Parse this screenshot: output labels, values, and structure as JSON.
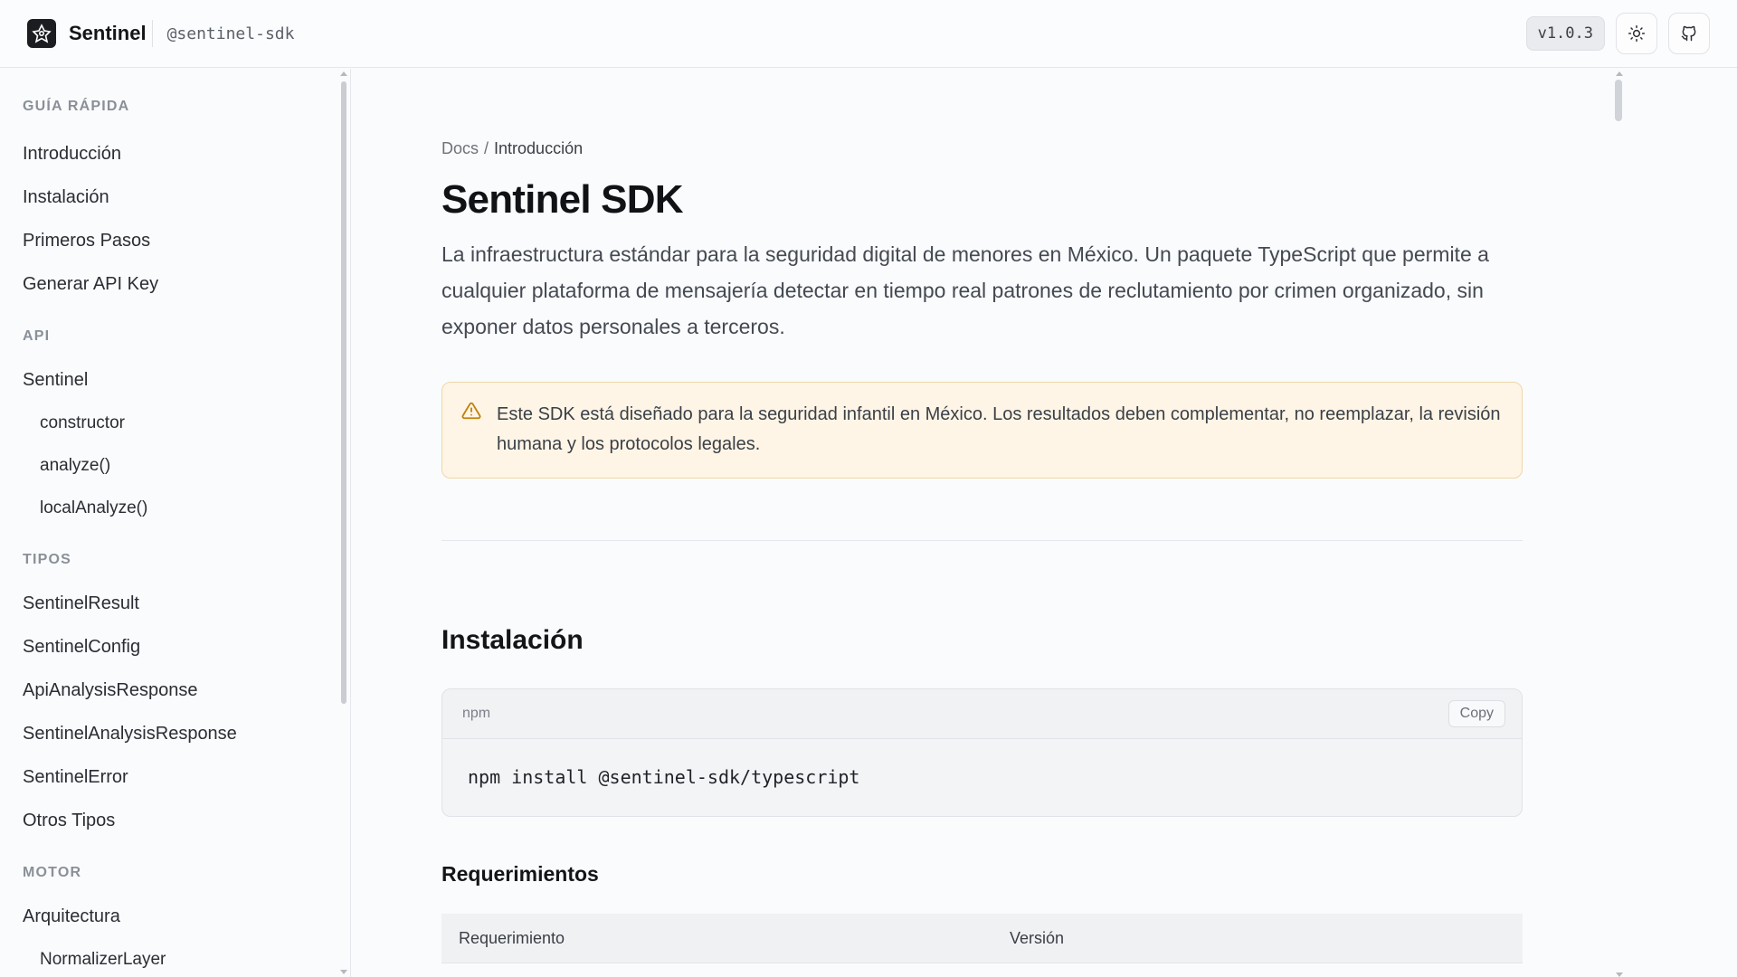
{
  "header": {
    "brand": "Sentinel",
    "package": "@sentinel-sdk",
    "version": "v1.0.3",
    "icons": {
      "logo": "sentinel-logo-icon",
      "theme": "sun-icon",
      "github": "github-icon"
    }
  },
  "sidebar": {
    "sections": [
      {
        "title": "GUÍA RÁPIDA",
        "items": [
          "Introducción",
          "Instalación",
          "Primeros Pasos",
          "Generar API Key"
        ]
      },
      {
        "title": "API",
        "items": [
          "Sentinel"
        ],
        "subitems": [
          "constructor",
          "analyze()",
          "localAnalyze()"
        ]
      },
      {
        "title": "TIPOS",
        "items": [
          "SentinelResult",
          "SentinelConfig",
          "ApiAnalysisResponse",
          "SentinelAnalysisResponse",
          "SentinelError",
          "Otros Tipos"
        ]
      },
      {
        "title": "MOTOR",
        "items": [
          "Arquitectura"
        ],
        "subitems": [
          "NormalizerLayer"
        ]
      }
    ]
  },
  "main": {
    "breadcrumb": {
      "root": "Docs",
      "separator": "/",
      "current": "Introducción"
    },
    "title": "Sentinel SDK",
    "lead": "La infraestructura estándar para la seguridad digital de menores en México. Un paquete TypeScript que permite a cualquier plataforma de mensajería detectar en tiempo real patrones de reclutamiento por crimen organizado, sin exponer datos personales a terceros.",
    "callout": {
      "icon": "warning-triangle-icon",
      "text": "Este SDK está diseñado para la seguridad infantil en México. Los resultados deben complementar, no reemplazar, la revisión humana y los protocolos legales."
    },
    "install": {
      "heading": "Instalación",
      "code_lang": "npm",
      "copy_label": "Copy",
      "command": "npm install @sentinel-sdk/typescript"
    },
    "requirements": {
      "heading": "Requerimientos",
      "columns": [
        "Requerimiento",
        "Versión"
      ]
    }
  },
  "colors": {
    "callout_bg": "#fef5e6",
    "callout_border": "#f0d7a8",
    "warning_icon": "#c2810c",
    "logo_bg": "#1c1d21"
  }
}
